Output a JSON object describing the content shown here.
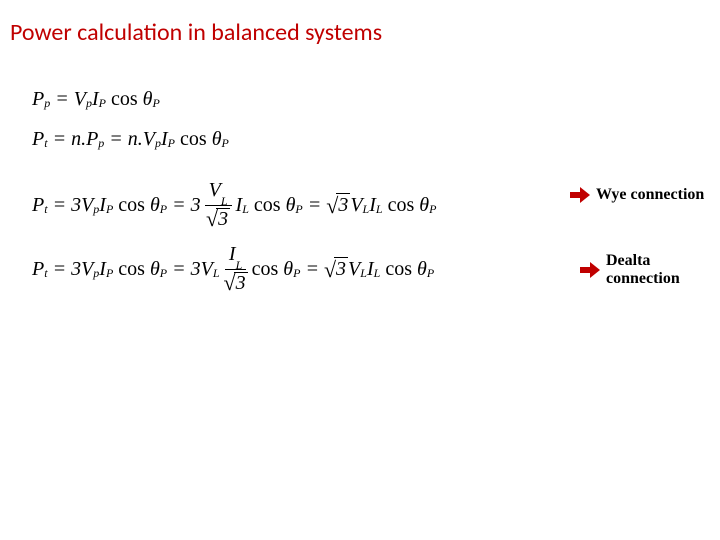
{
  "title": "Power calculation in balanced systems",
  "equations": {
    "eq1": {
      "lhs": "P",
      "lhs_sub": "p",
      "rhs_terms": [
        "V_p",
        "I_P",
        "cos θ_P"
      ]
    },
    "eq2": {
      "lhs": "P",
      "lhs_sub": "t",
      "mid": "n.P_p",
      "rhs_terms": [
        "n.V_p",
        "I_P",
        "cos θ_P"
      ]
    },
    "eq3": {
      "lhs": "P",
      "lhs_sub": "t",
      "first": "3V_p I_P cos θ_P",
      "frac_num": "V_L",
      "frac_den": "√3",
      "after_frac": "I_L cos θ_P",
      "final": "√3 V_L I_L cos θ_P"
    },
    "eq4": {
      "lhs": "P",
      "lhs_sub": "t",
      "first": "3V_p I_P cos θ_P",
      "frac_num": "I_L",
      "frac_den": "√3",
      "before_frac": "3V_L",
      "after_frac": "cos θ_P",
      "final": "√3 V_L I_L cos θ_P"
    }
  },
  "annotations": {
    "wye": "Wye connection",
    "delta": "Dealta connection"
  },
  "symbols": {
    "P": "P",
    "V": "V",
    "I": "I",
    "cos": "cos",
    "theta": "θ",
    "n": "n",
    "three": "3",
    "eq": "=",
    "dot": ".",
    "sqrt": "√"
  },
  "subs": {
    "p": "p",
    "P": "P",
    "t": "t",
    "L": "L"
  },
  "colors": {
    "title": "#c00000",
    "arrow": "#c00000"
  }
}
